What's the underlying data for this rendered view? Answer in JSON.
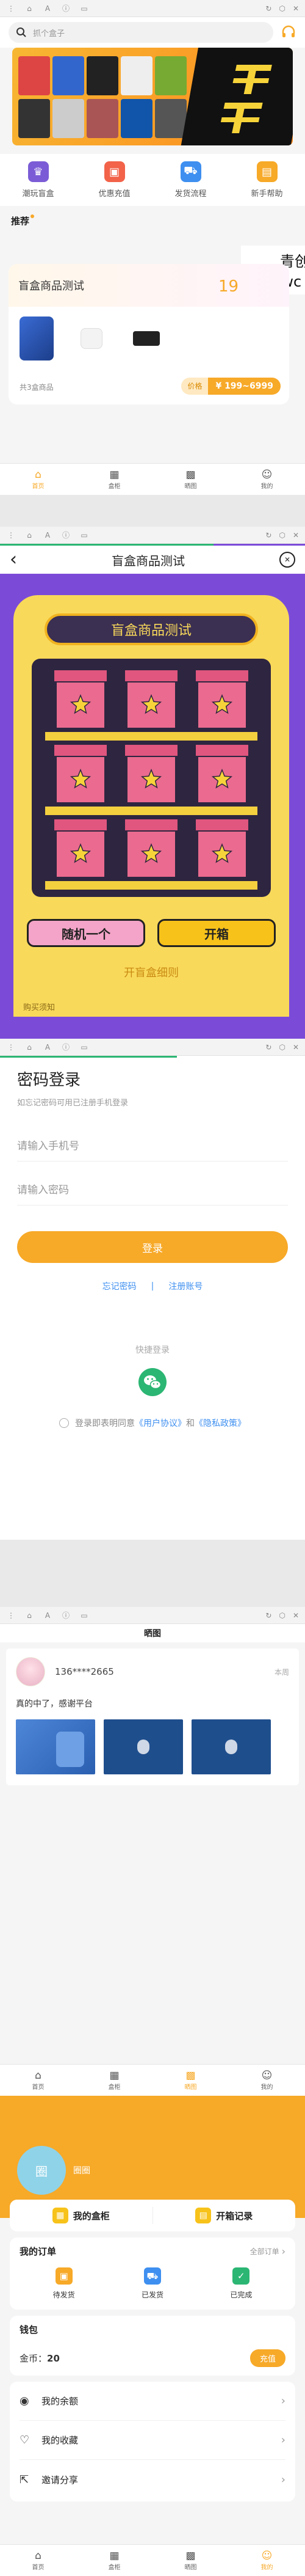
{
  "browser": {
    "menu_icon": "⋮",
    "home_icon": "⌂",
    "font_icon": "A",
    "info_icon": "ⓘ",
    "tab_icon": "▭",
    "refresh_icon": "↻",
    "lock_icon": "⬡",
    "close_icon": "✕"
  },
  "home": {
    "search_placeholder": "抓个盒子",
    "shortcuts": [
      {
        "label": "潮玩盲盒",
        "icon": "♛",
        "color": "#7b5cd6"
      },
      {
        "label": "优惠充值",
        "icon": "▣",
        "color": "#f2634a"
      },
      {
        "label": "发货流程",
        "icon": "⛟",
        "color": "#3e8ff0"
      },
      {
        "label": "新手帮助",
        "icon": "▤",
        "color": "#f7a928"
      }
    ],
    "section_title": "推荐",
    "product_title": "盲盒商品测试",
    "peek_number": "19",
    "product_count": "共3盒商品",
    "price_label": "价格",
    "price_value": "¥ 199~6999",
    "overlay_line1": "青创",
    "overlay_line2": "www.wc"
  },
  "tabs": [
    {
      "icon": "⌂",
      "label": "首页"
    },
    {
      "icon": "▦",
      "label": "盒柜"
    },
    {
      "icon": "▩",
      "label": "晒图"
    },
    {
      "icon": "☺",
      "label": "我的"
    }
  ],
  "machine": {
    "back_icon": "‹",
    "title": "盲盒商品测试",
    "sound_icon": "🔇",
    "sign": "盲盒商品测试",
    "random_button": "随机一个",
    "open_button": "开箱",
    "rules_link": "开盲盒细则",
    "purchase_note": "购买须知"
  },
  "login": {
    "title": "密码登录",
    "subtitle": "如忘记密码可用已注册手机登录",
    "phone_placeholder": "请输入手机号",
    "password_placeholder": "请输入密码",
    "login_button": "登录",
    "forgot_link": "忘记密码",
    "register_link": "注册账号",
    "divider": "|",
    "quick_login": "快捷登录",
    "wechat_icon": "wechat-icon",
    "agree_prefix": "登录即表明同意",
    "user_agreement": "《用户协议》",
    "and": "和",
    "privacy_policy": "《隐私政策》"
  },
  "share": {
    "title": "晒图",
    "user_phone": "136****2665",
    "post_time": "本周",
    "post_text": "真的中了，感谢平台"
  },
  "profile": {
    "avatar_text": "圈",
    "nickname": "圈圈",
    "box_cabinet": "我的盒柜",
    "open_records": "开箱记录",
    "orders_title": "我的订单",
    "all_orders": "全部订单",
    "order_statuses": [
      {
        "label": "待发货",
        "icon": "▣",
        "color": "#f7a928"
      },
      {
        "label": "已发货",
        "icon": "⛟",
        "color": "#3e8ff0"
      },
      {
        "label": "已完成",
        "icon": "✓",
        "color": "#2bb673"
      }
    ],
    "wallet_title": "钱包",
    "coins_label": "金币：",
    "coins_value": "20",
    "recharge_button": "充值",
    "menu": [
      {
        "label": "我的余额",
        "icon": "◉"
      },
      {
        "label": "我的收藏",
        "icon": "♡"
      },
      {
        "label": "邀请分享",
        "icon": "⇱"
      }
    ]
  }
}
